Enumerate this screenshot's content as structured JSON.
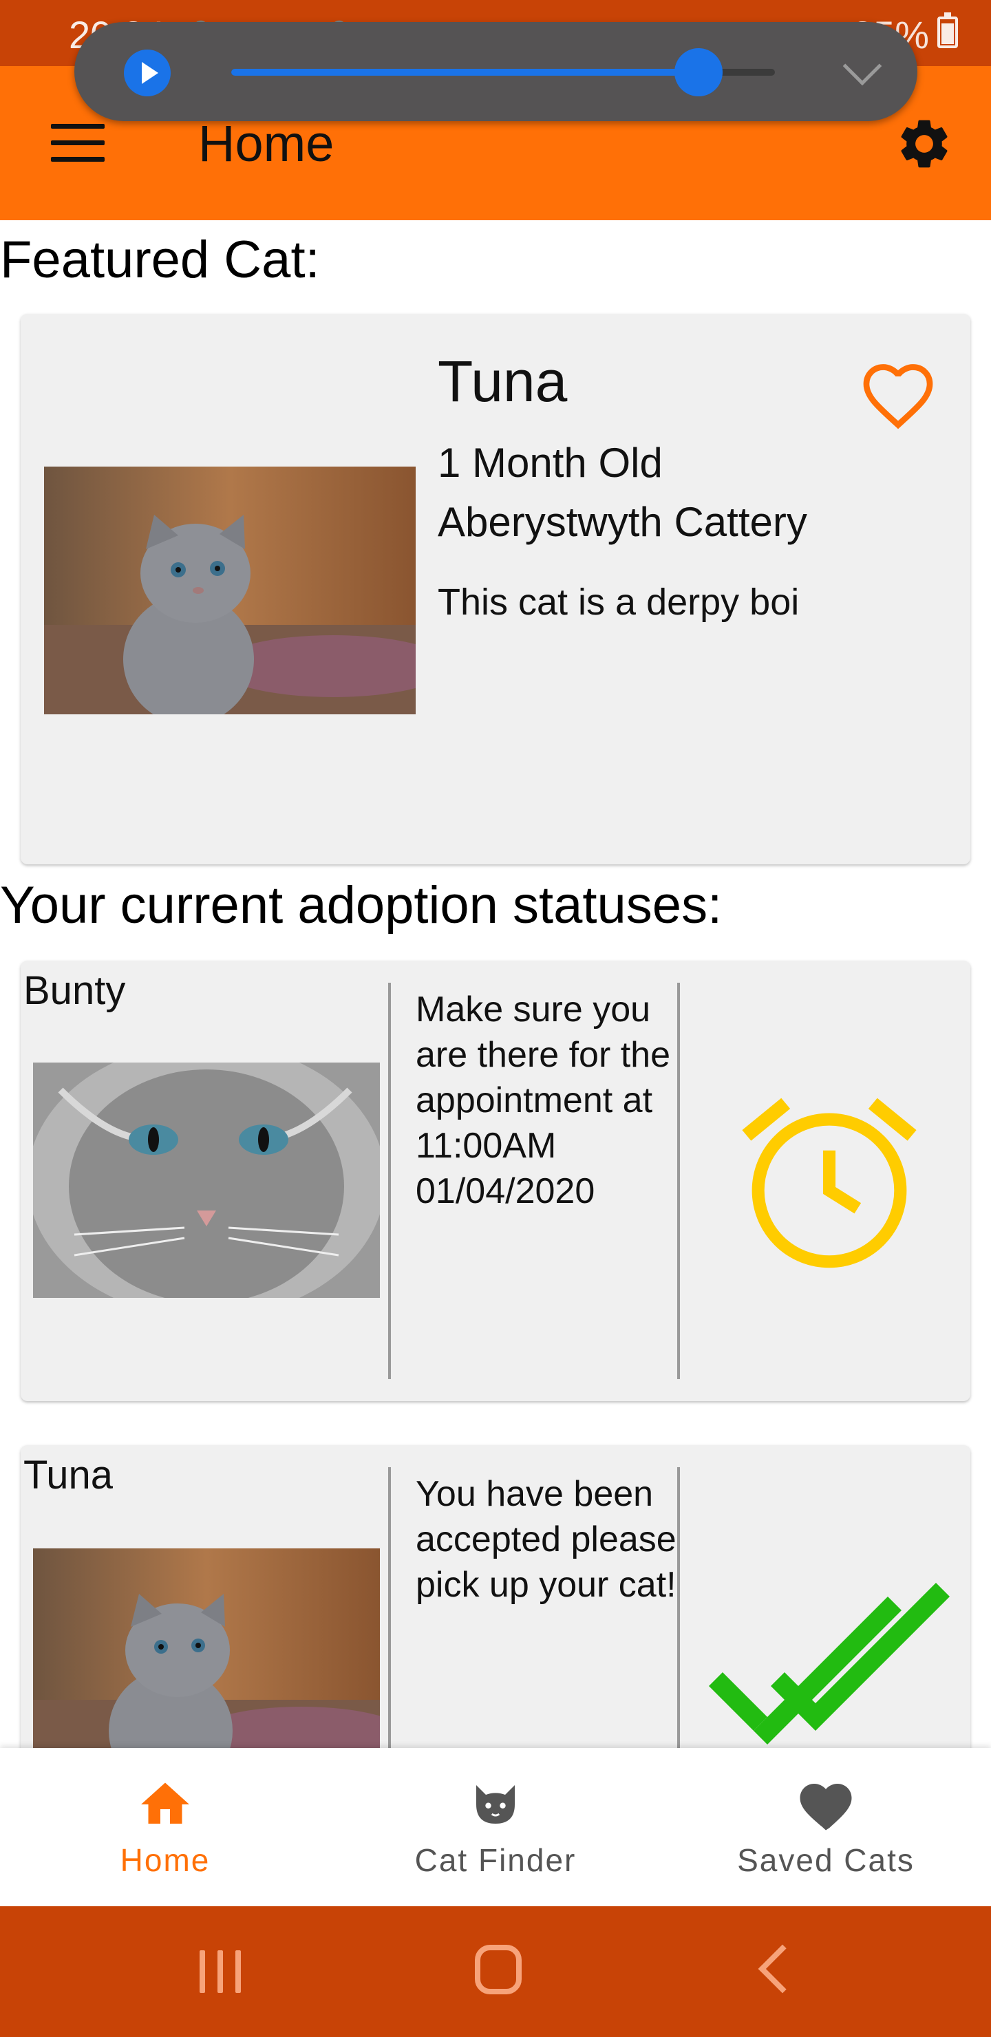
{
  "status_bar": {
    "time": "20:24",
    "battery": "85%",
    "notification_icons": [
      "twitter-icon",
      "instagram-icon",
      "gallery-icon",
      "twitter-icon"
    ]
  },
  "media_player": {
    "progress": 0.86,
    "accent": "#1a73e8"
  },
  "app_bar": {
    "title": "Home",
    "color": "#ff7007"
  },
  "featured": {
    "heading": "Featured Cat:",
    "cat": {
      "name": "Tuna",
      "age": "1 Month Old",
      "location": "Aberystwyth Cattery",
      "description": "This cat is a derpy boi",
      "favorite_icon": "heart-outline-icon"
    }
  },
  "adoptions": {
    "heading": "Your current adoption statuses:",
    "items": [
      {
        "name": "Bunty",
        "message": "Make sure you are there for the appointment at 11:00AM 01/04/2020",
        "status_icon": "alarm-clock-icon",
        "status_color": "#ffcc00"
      },
      {
        "name": "Tuna",
        "message": "You have been accepted please pick up your cat!",
        "status_icon": "double-check-icon",
        "status_color": "#22bb11"
      }
    ]
  },
  "bottom_nav": {
    "items": [
      {
        "label": "Home",
        "icon": "home-icon",
        "active": true
      },
      {
        "label": "Cat Finder",
        "icon": "cat-icon",
        "active": false
      },
      {
        "label": "Saved Cats",
        "icon": "heart-icon",
        "active": false
      }
    ],
    "active_color": "#ff7007",
    "inactive_color": "#555555"
  }
}
